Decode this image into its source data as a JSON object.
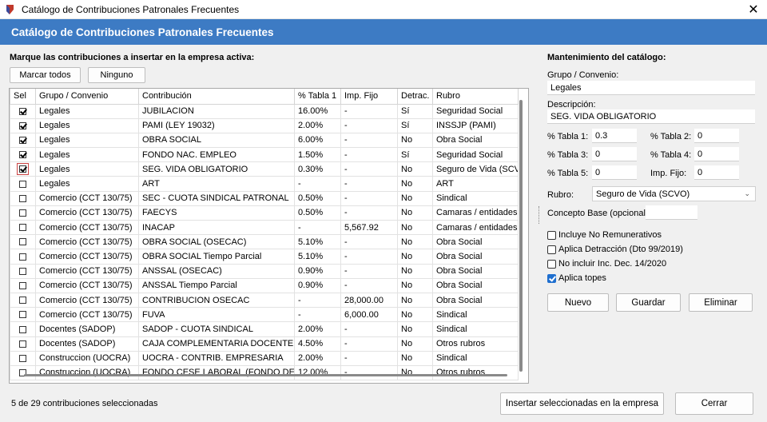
{
  "window": {
    "title": "Catálogo de Contribuciones Patronales Frecuentes",
    "close_glyph": "✕"
  },
  "banner": {
    "title": "Catálogo de Contribuciones Patronales Frecuentes"
  },
  "left": {
    "instruction": "Marque las contribuciones a insertar en la empresa activa:",
    "mark_all": "Marcar todos",
    "none": "Ninguno"
  },
  "grid": {
    "columns": [
      "Sel",
      "Grupo / Convenio",
      "Contribución",
      "% Tabla 1",
      "Imp. Fijo",
      "Detrac.",
      "Rubro"
    ],
    "rows": [
      {
        "checked": true,
        "focus": false,
        "grupo": "Legales",
        "contribucion": "JUBILACION",
        "tabla1": "16.00%",
        "fijo": "-",
        "detrac": "Sí",
        "rubro": "Seguridad Social"
      },
      {
        "checked": true,
        "focus": false,
        "grupo": "Legales",
        "contribucion": "PAMI (LEY 19032)",
        "tabla1": "2.00%",
        "fijo": "-",
        "detrac": "Sí",
        "rubro": "INSSJP (PAMI)"
      },
      {
        "checked": true,
        "focus": false,
        "grupo": "Legales",
        "contribucion": "OBRA SOCIAL",
        "tabla1": "6.00%",
        "fijo": "-",
        "detrac": "No",
        "rubro": "Obra Social"
      },
      {
        "checked": true,
        "focus": false,
        "grupo": "Legales",
        "contribucion": "FONDO NAC. EMPLEO",
        "tabla1": "1.50%",
        "fijo": "-",
        "detrac": "Sí",
        "rubro": "Seguridad Social"
      },
      {
        "checked": true,
        "focus": true,
        "grupo": "Legales",
        "contribucion": "SEG. VIDA OBLIGATORIO",
        "tabla1": "0.30%",
        "fijo": "-",
        "detrac": "No",
        "rubro": "Seguro de Vida (SCVO)"
      },
      {
        "checked": false,
        "focus": false,
        "grupo": "Legales",
        "contribucion": "ART",
        "tabla1": "-",
        "fijo": "-",
        "detrac": "No",
        "rubro": "ART"
      },
      {
        "checked": false,
        "focus": false,
        "grupo": "Comercio (CCT 130/75)",
        "contribucion": "SEC - CUOTA SINDICAL PATRONAL",
        "tabla1": "0.50%",
        "fijo": "-",
        "detrac": "No",
        "rubro": "Sindical"
      },
      {
        "checked": false,
        "focus": false,
        "grupo": "Comercio (CCT 130/75)",
        "contribucion": "FAECYS",
        "tabla1": "0.50%",
        "fijo": "-",
        "detrac": "No",
        "rubro": "Camaras / entidades"
      },
      {
        "checked": false,
        "focus": false,
        "grupo": "Comercio (CCT 130/75)",
        "contribucion": "INACAP",
        "tabla1": "-",
        "fijo": "5,567.92",
        "detrac": "No",
        "rubro": "Camaras / entidades"
      },
      {
        "checked": false,
        "focus": false,
        "grupo": "Comercio (CCT 130/75)",
        "contribucion": "OBRA SOCIAL (OSECAC)",
        "tabla1": "5.10%",
        "fijo": "-",
        "detrac": "No",
        "rubro": "Obra Social"
      },
      {
        "checked": false,
        "focus": false,
        "grupo": "Comercio (CCT 130/75)",
        "contribucion": "OBRA SOCIAL Tiempo Parcial",
        "tabla1": "5.10%",
        "fijo": "-",
        "detrac": "No",
        "rubro": "Obra Social"
      },
      {
        "checked": false,
        "focus": false,
        "grupo": "Comercio (CCT 130/75)",
        "contribucion": "ANSSAL (OSECAC)",
        "tabla1": "0.90%",
        "fijo": "-",
        "detrac": "No",
        "rubro": "Obra Social"
      },
      {
        "checked": false,
        "focus": false,
        "grupo": "Comercio (CCT 130/75)",
        "contribucion": "ANSSAL Tiempo Parcial",
        "tabla1": "0.90%",
        "fijo": "-",
        "detrac": "No",
        "rubro": "Obra Social"
      },
      {
        "checked": false,
        "focus": false,
        "grupo": "Comercio (CCT 130/75)",
        "contribucion": "CONTRIBUCION OSECAC",
        "tabla1": "-",
        "fijo": "28,000.00",
        "detrac": "No",
        "rubro": "Obra Social"
      },
      {
        "checked": false,
        "focus": false,
        "grupo": "Comercio (CCT 130/75)",
        "contribucion": "FUVA",
        "tabla1": "-",
        "fijo": "6,000.00",
        "detrac": "No",
        "rubro": "Sindical"
      },
      {
        "checked": false,
        "focus": false,
        "grupo": "Docentes (SADOP)",
        "contribucion": "SADOP - CUOTA SINDICAL",
        "tabla1": "2.00%",
        "fijo": "-",
        "detrac": "No",
        "rubro": "Sindical"
      },
      {
        "checked": false,
        "focus": false,
        "grupo": "Docentes (SADOP)",
        "contribucion": "CAJA COMPLEMENTARIA DOCENTE",
        "tabla1": "4.50%",
        "fijo": "-",
        "detrac": "No",
        "rubro": "Otros rubros"
      },
      {
        "checked": false,
        "focus": false,
        "grupo": "Construccion (UOCRA)",
        "contribucion": "UOCRA - CONTRIB. EMPRESARIA",
        "tabla1": "2.00%",
        "fijo": "-",
        "detrac": "No",
        "rubro": "Sindical"
      },
      {
        "checked": false,
        "focus": false,
        "grupo": "Construccion (UOCRA)",
        "contribucion": "FONDO CESE LABORAL (FONDO DESEM",
        "tabla1": "12.00%",
        "fijo": "-",
        "detrac": "No",
        "rubro": "Otros rubros"
      }
    ]
  },
  "right": {
    "heading": "Mantenimiento del catálogo:",
    "grupo_label": "Grupo / Convenio:",
    "grupo_value": "Legales",
    "desc_label": "Descripción:",
    "desc_value": "SEG. VIDA OBLIGATORIO",
    "t1_label": "% Tabla 1:",
    "t1_value": "0.3",
    "t2_label": "% Tabla 2:",
    "t2_value": "0",
    "t3_label": "% Tabla 3:",
    "t3_value": "0",
    "t4_label": "% Tabla 4:",
    "t4_value": "0",
    "t5_label": "% Tabla 5:",
    "t5_value": "0",
    "fijo_label": "Imp. Fijo:",
    "fijo_value": "0",
    "rubro_label": "Rubro:",
    "rubro_value": "Seguro de Vida (SCVO)",
    "concepto_label": "Concepto Base (opcional):",
    "concepto_value": "",
    "checks": [
      {
        "label": "Incluye No Remunerativos",
        "checked": false
      },
      {
        "label": "Aplica Detracción (Dto 99/2019)",
        "checked": false
      },
      {
        "label": "No incluir Inc. Dec. 14/2020",
        "checked": false
      },
      {
        "label": "Aplica topes",
        "checked": true
      }
    ],
    "nuevo": "Nuevo",
    "guardar": "Guardar",
    "eliminar": "Eliminar"
  },
  "footer": {
    "status": "5 de 29 contribuciones seleccionadas",
    "insert": "Insertar seleccionadas en la empresa",
    "close": "Cerrar"
  }
}
